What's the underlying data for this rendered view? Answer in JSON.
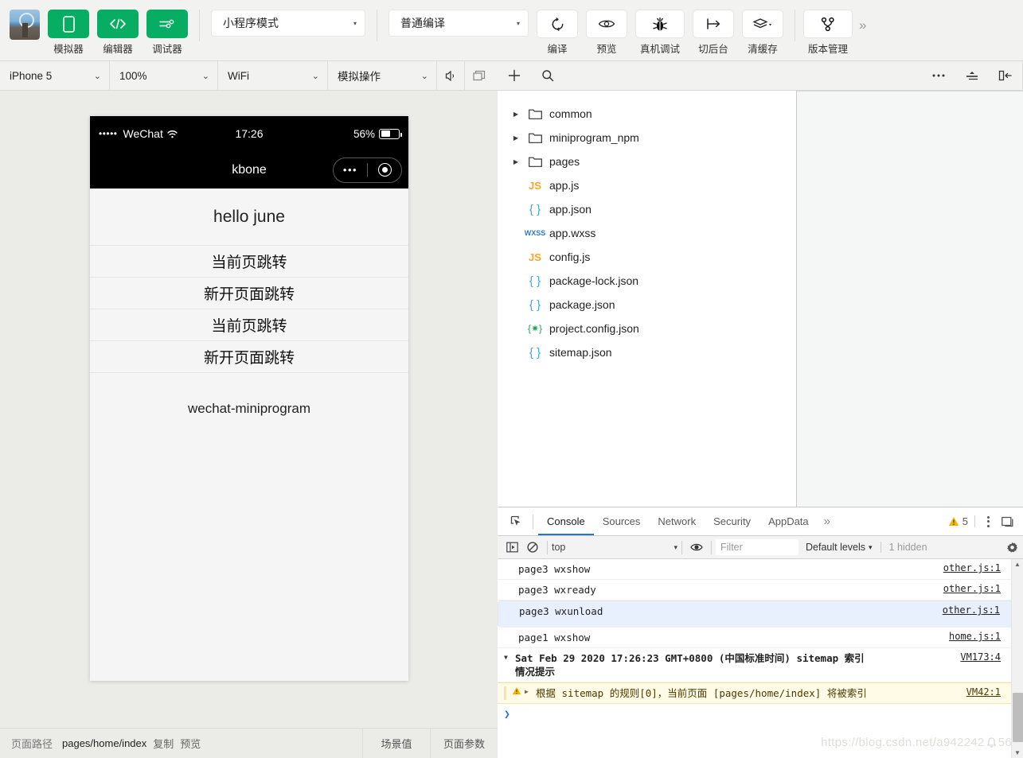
{
  "toolbar": {
    "avatar_name": "user-avatar",
    "buttons": [
      {
        "label": "模拟器",
        "icon": "phone-icon",
        "style": "green"
      },
      {
        "label": "编辑器",
        "icon": "code-icon",
        "style": "green"
      },
      {
        "label": "调试器",
        "icon": "sliders-icon",
        "style": "green"
      }
    ],
    "mode_select": {
      "value": "小程序模式",
      "caret": "▾"
    },
    "compile_select": {
      "value": "普通编译",
      "caret": "▾"
    },
    "actions": [
      {
        "label": "编译",
        "icon": "refresh-icon"
      },
      {
        "label": "预览",
        "icon": "eye-icon"
      },
      {
        "label": "真机调试",
        "icon": "bug-icon"
      },
      {
        "label": "切后台",
        "icon": "background-icon"
      },
      {
        "label": "清缓存",
        "icon": "layers-icon",
        "has_caret": true
      },
      {
        "label": "版本管理",
        "icon": "git-branch-icon"
      }
    ],
    "overflow": "»"
  },
  "sim_toolbar": {
    "device": {
      "value": "iPhone 5",
      "caret": "⌄"
    },
    "zoom": {
      "value": "100%",
      "caret": "⌄"
    },
    "network": {
      "value": "WiFi",
      "caret": "⌄"
    },
    "action": {
      "value": "模拟操作",
      "caret": "⌄"
    },
    "volume_icon": "volume-icon",
    "screen_icon": "window-icon"
  },
  "editor_toolbar": {
    "add_icon": "plus-icon",
    "search_icon": "search-icon",
    "more_icon": "ellipsis-icon",
    "collapse_icon": "collapse-all-icon",
    "panel_icon": "toggle-panel-icon"
  },
  "phone": {
    "status": {
      "signal_dots": "•••••",
      "carrier": "WeChat",
      "wifi": "◗",
      "time": "17:26",
      "battery_percent": "56%",
      "battery_level": 56
    },
    "nav": {
      "title": "kbone",
      "capsule_dots": "•••",
      "capsule_target_name": "capsule-target-icon"
    },
    "content": {
      "heading": "hello june",
      "items": [
        "当前页跳转",
        "新开页面跳转",
        "当前页跳转",
        "新开页面跳转"
      ],
      "footer": "wechat-miniprogram"
    }
  },
  "file_tree": [
    {
      "name": "common",
      "type": "folder",
      "arrow": "▶",
      "expanded": false
    },
    {
      "name": "miniprogram_npm",
      "type": "folder",
      "arrow": "▶",
      "expanded": false
    },
    {
      "name": "pages",
      "type": "folder",
      "arrow": "▶",
      "expanded": false
    },
    {
      "name": "app.js",
      "type": "js",
      "icon_text": "JS"
    },
    {
      "name": "app.json",
      "type": "json",
      "icon_text": "{ }"
    },
    {
      "name": "app.wxss",
      "type": "wxss",
      "icon_text": "WXSS"
    },
    {
      "name": "config.js",
      "type": "js",
      "icon_text": "JS"
    },
    {
      "name": "package-lock.json",
      "type": "json",
      "icon_text": "{ }"
    },
    {
      "name": "package.json",
      "type": "json",
      "icon_text": "{ }"
    },
    {
      "name": "project.config.json",
      "type": "pcfg",
      "icon_text": "{✷}"
    },
    {
      "name": "sitemap.json",
      "type": "json",
      "icon_text": "{ }"
    }
  ],
  "devtools": {
    "inspect_icon": "inspect-element-icon",
    "tabs": [
      {
        "label": "Console",
        "active": true
      },
      {
        "label": "Sources",
        "active": false
      },
      {
        "label": "Network",
        "active": false
      },
      {
        "label": "Security",
        "active": false
      },
      {
        "label": "AppData",
        "active": false
      }
    ],
    "tabs_overflow": "»",
    "warning_icon": "warning-triangle-icon",
    "warning_count": "5",
    "kebab_name": "more-options-icon",
    "dock_icon": "dock-panel-icon",
    "filterbar": {
      "sidebar_icon": "show-console-sidebar-icon",
      "clear_icon": "clear-console-icon",
      "context": "top",
      "context_caret": "▾",
      "eye_icon": "live-expression-icon",
      "filter_placeholder": "Filter",
      "levels_label": "Default levels",
      "levels_caret": "▾",
      "hidden_label": "1 hidden",
      "gear_icon": "console-settings-icon"
    },
    "logs": [
      {
        "message": "page3 wxshow",
        "source": "other.js:1",
        "kind": "log",
        "selected": false
      },
      {
        "message": "page3 wxready",
        "source": "other.js:1",
        "kind": "log",
        "selected": false
      },
      {
        "message": "page3 wxunload",
        "source": "other.js:1",
        "kind": "log",
        "selected": true
      },
      {
        "message": "page1 wxshow",
        "source": "home.js:1",
        "kind": "log",
        "selected": false
      },
      {
        "message": "Sat Feb 29 2020 17:26:23 GMT+0800 (中国标准时间) sitemap 索引\n情况提示",
        "source": "VM173:4",
        "kind": "group",
        "arrow": "▼"
      },
      {
        "message": "根据 sitemap 的规则[0]，当前页面 [pages/home/index] 将被索引",
        "source": "VM42:1",
        "kind": "warning",
        "arrow": "▶"
      }
    ],
    "prompt_glyph": "❯",
    "scrollbar": {
      "up": "▲",
      "down": "▼"
    }
  },
  "bottom_bar": {
    "path_label": "页面路径",
    "path_value": "pages/home/index",
    "copy_label": "复制",
    "preview_label": "预览",
    "scene_button": "场景值",
    "params_button": "页面参数"
  },
  "watermark": "https://blog.csdn.net/a942242",
  "watermark_tail": "56",
  "colors": {
    "brand_green": "#07ad62",
    "accent_blue": "#1a73e8",
    "warning_yellow": "#e8a11c",
    "chrome_bg": "#f2f2f0"
  }
}
